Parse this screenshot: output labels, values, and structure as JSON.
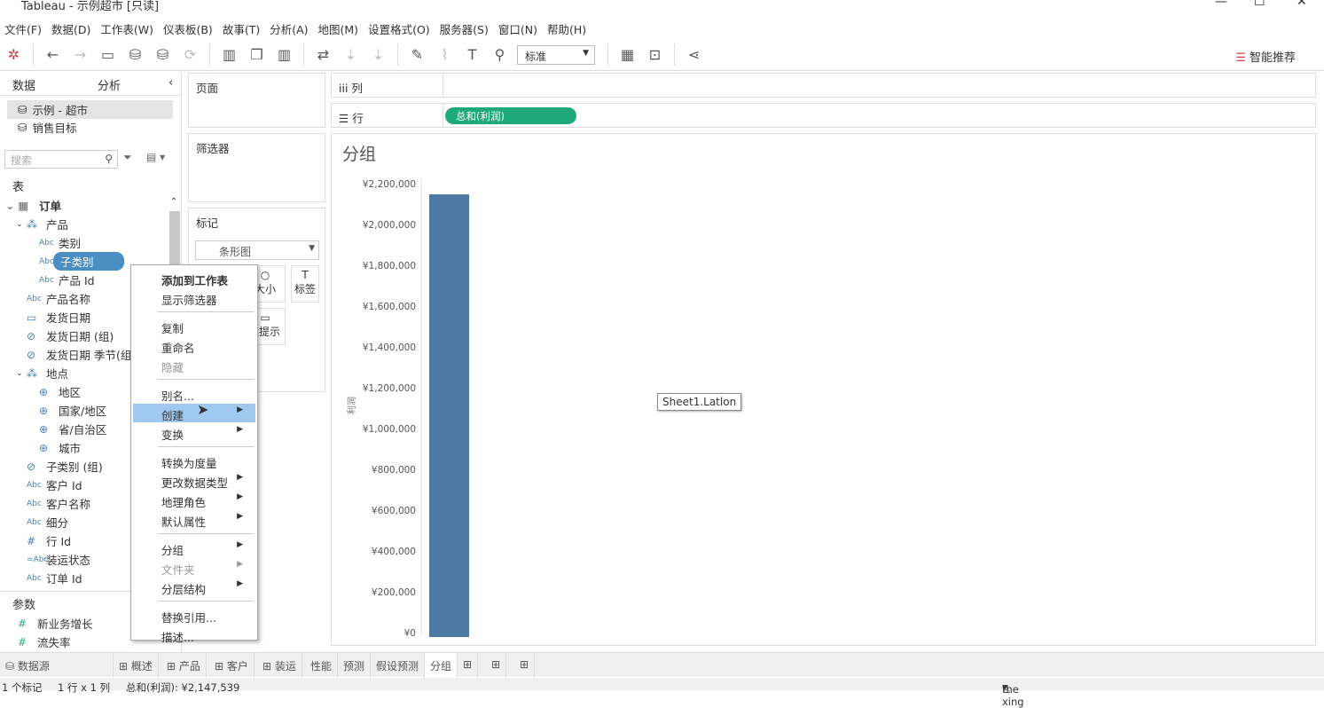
{
  "window": {
    "title": "Tableau - 示例超市 [只读]",
    "min": "—",
    "max": "☐",
    "close": "✕"
  },
  "menu": [
    "文件(F)",
    "数据(D)",
    "工作表(W)",
    "仪表板(B)",
    "故事(T)",
    "分析(A)",
    "地图(M)",
    "设置格式(O)",
    "服务器(S)",
    "窗口(N)",
    "帮助(H)"
  ],
  "toolbar": {
    "fit_select": "标准",
    "smart": "智能推荐"
  },
  "sidebar": {
    "tab_data": "数据",
    "tab_analysis": "分析",
    "datasources": [
      "示例 - 超市",
      "销售目标"
    ],
    "search_placeholder": "搜索",
    "tables_header": "表",
    "table": "订单",
    "fields": [
      {
        "icon": "hierarchy",
        "label": "产品",
        "level": 1
      },
      {
        "icon": "Abc",
        "label": "类别",
        "level": 2
      },
      {
        "icon": "Abc",
        "label": "子类别",
        "level": 2,
        "selected": true
      },
      {
        "icon": "Abc",
        "label": "产品 Id",
        "level": 2
      },
      {
        "icon": "Abc",
        "label": "产品名称",
        "level": 1
      },
      {
        "icon": "date",
        "label": "发货日期",
        "level": 1
      },
      {
        "icon": "clip",
        "label": "发货日期 (组)",
        "level": 1
      },
      {
        "icon": "clip",
        "label": "发货日期 季节(组)",
        "level": 1
      },
      {
        "icon": "hierarchy",
        "label": "地点",
        "level": 1
      },
      {
        "icon": "globe",
        "label": "地区",
        "level": 2
      },
      {
        "icon": "globe",
        "label": "国家/地区",
        "level": 2
      },
      {
        "icon": "globe",
        "label": "省/自治区",
        "level": 2
      },
      {
        "icon": "globe",
        "label": "城市",
        "level": 2
      },
      {
        "icon": "clip",
        "label": "子类别 (组)",
        "level": 1
      },
      {
        "icon": "Abc",
        "label": "客户 Id",
        "level": 1
      },
      {
        "icon": "Abc",
        "label": "客户名称",
        "level": 1
      },
      {
        "icon": "Abc",
        "label": "细分",
        "level": 1
      },
      {
        "icon": "#",
        "label": "行 Id",
        "level": 1
      },
      {
        "icon": "=Abc",
        "label": "装运状态",
        "level": 1
      },
      {
        "icon": "Abc",
        "label": "订单 Id",
        "level": 1
      }
    ],
    "params_header": "参数",
    "params": [
      "新业务增长",
      "流失率"
    ]
  },
  "cards": {
    "pages": "页面",
    "filters": "筛选器",
    "marks": "标记",
    "mark_type": "条形图",
    "size": "大小",
    "label": "标签",
    "tooltip": "工具提示"
  },
  "shelves": {
    "columns": "列",
    "rows": "行",
    "row_pill": "总和(利润)"
  },
  "context_menu": [
    {
      "label": "添加到工作表",
      "bold": true
    },
    {
      "label": "显示筛选器"
    },
    {
      "sep": true
    },
    {
      "label": "复制"
    },
    {
      "label": "重命名"
    },
    {
      "label": "隐藏",
      "disabled": true
    },
    {
      "sep": true
    },
    {
      "label": "别名..."
    },
    {
      "label": "创建",
      "submenu": true,
      "highlighted": true
    },
    {
      "label": "变换",
      "submenu": true
    },
    {
      "sep": true
    },
    {
      "label": "转换为度量"
    },
    {
      "label": "更改数据类型",
      "submenu": true
    },
    {
      "label": "地理角色",
      "submenu": true
    },
    {
      "label": "默认属性",
      "submenu": true
    },
    {
      "sep": true
    },
    {
      "label": "分组",
      "submenu": true
    },
    {
      "label": "文件夹",
      "submenu": true,
      "disabled": true
    },
    {
      "label": "分层结构",
      "submenu": true
    },
    {
      "sep": true
    },
    {
      "label": "替换引用..."
    },
    {
      "label": "描述..."
    }
  ],
  "tooltip_text": "Sheet1.Latlon",
  "view": {
    "title": "分组"
  },
  "chart_data": {
    "type": "bar",
    "categories": [
      ""
    ],
    "values": [
      2147539
    ],
    "ylabel": "利润",
    "ylim": [
      0,
      2200000
    ],
    "yticks": [
      "¥0",
      "¥200,000",
      "¥400,000",
      "¥600,000",
      "¥800,000",
      "¥1,000,000",
      "¥1,200,000",
      "¥1,400,000",
      "¥1,600,000",
      "¥1,800,000",
      "¥2,000,000",
      "¥2,200,000"
    ],
    "color": "#4e79a7",
    "grid": false
  },
  "tabs": {
    "datasource": "数据源",
    "sheets": [
      "概述",
      "产品",
      "客户",
      "装运",
      "性能",
      "预测",
      "假设预测",
      "分组"
    ],
    "active": "分组"
  },
  "status": {
    "marks": "1 个标记",
    "dims": "1 行 x 1 列",
    "sum": "总和(利润): ¥2,147,539",
    "user": "the xing"
  }
}
